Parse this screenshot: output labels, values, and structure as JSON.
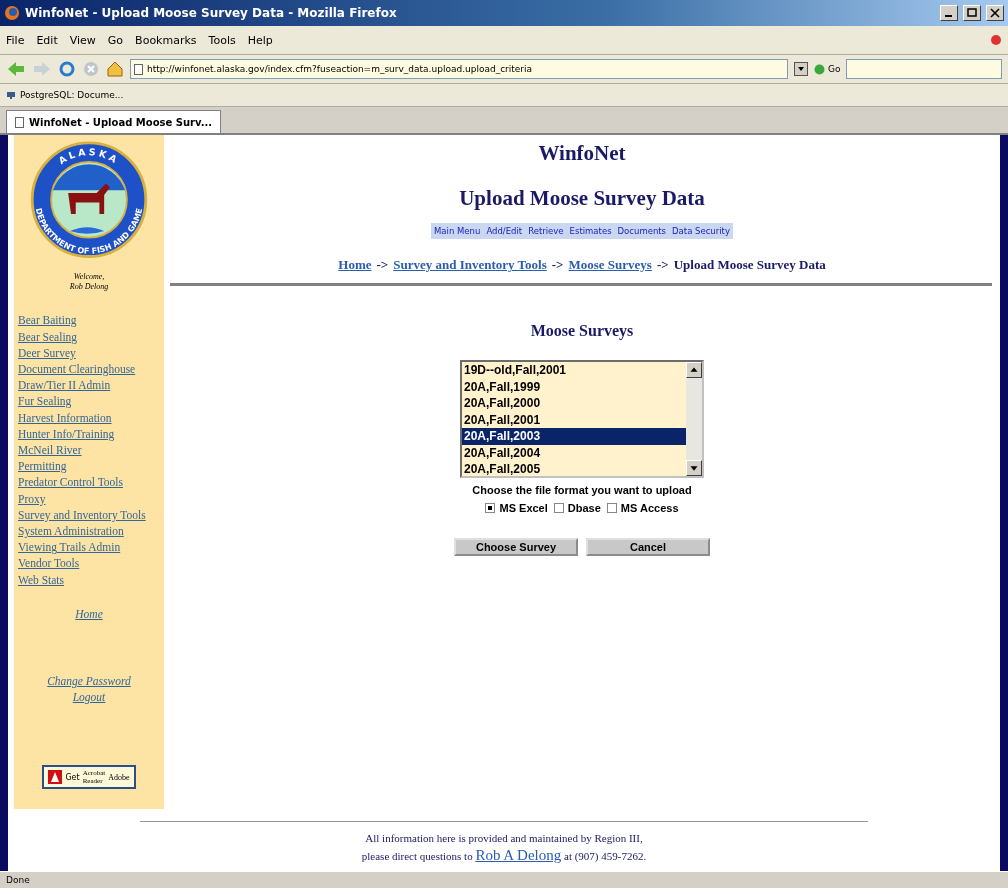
{
  "window": {
    "title": "WinfoNet - Upload Moose Survey Data - Mozilla Firefox"
  },
  "menu": [
    "File",
    "Edit",
    "View",
    "Go",
    "Bookmarks",
    "Tools",
    "Help"
  ],
  "toolbar": {
    "url": "http://winfonet.alaska.gov/index.cfm?fuseaction=m_surv_data.upload.upload_criteria",
    "go_label": "Go"
  },
  "bookmarks": [
    "PostgreSQL: Docume..."
  ],
  "tabs": [
    {
      "label": "WinfoNet - Upload Moose Surv...",
      "selected": true
    }
  ],
  "sidebar": {
    "logo": {
      "top_text": "ALASKA",
      "ring_text": "DEPARTMENT OF FISH AND GAME"
    },
    "welcome": [
      "Welcome,",
      "Rob Delong"
    ],
    "links": [
      "Bear Baiting",
      "Bear Sealing",
      "Deer Survey",
      "Document Clearinghouse",
      "Draw/Tier II Admin",
      "Fur Sealing",
      "Harvest Information",
      "Hunter Info/Training",
      "McNeil River",
      "Permitting",
      "Predator Control Tools",
      "Proxy",
      "Survey and Inventory Tools",
      "System Administration",
      "Viewing Trails Admin",
      "Vendor Tools",
      "Web Stats"
    ],
    "home_link": "Home",
    "account_links": [
      "Change Password",
      "Logout"
    ],
    "acrobat_badge": {
      "get": "Get",
      "product": "Acrobat",
      "reader": "Reader",
      "maker": "Adobe"
    }
  },
  "main": {
    "site_title": "WinfoNet",
    "page_title": "Upload Moose Survey Data",
    "nav_menu": [
      "Main Menu",
      "Add/Edit",
      "Retrieve",
      "Estimates",
      "Documents",
      "Data Security"
    ],
    "breadcrumb": [
      {
        "kind": "link",
        "text": "Home"
      },
      {
        "kind": "separator",
        "text": "->"
      },
      {
        "kind": "link",
        "text": "Survey and Inventory Tools"
      },
      {
        "kind": "separator",
        "text": "->"
      },
      {
        "kind": "link",
        "text": "Moose Surveys"
      },
      {
        "kind": "separator",
        "text": "->"
      },
      {
        "kind": "current",
        "text": "Upload Moose Survey Data"
      }
    ],
    "section_title": "Moose Surveys",
    "surveys": [
      {
        "label": "19D--old,Fall,2001",
        "selected": false
      },
      {
        "label": "20A,Fall,1999",
        "selected": false
      },
      {
        "label": "20A,Fall,2000",
        "selected": false
      },
      {
        "label": "20A,Fall,2001",
        "selected": false
      },
      {
        "label": "20A,Fall,2003",
        "selected": true
      },
      {
        "label": "20A,Fall,2004",
        "selected": false
      },
      {
        "label": "20A,Fall,2005",
        "selected": false
      }
    ],
    "format_prompt": "Choose the file format you want to upload",
    "formats": [
      {
        "label": "MS Excel",
        "selected": true
      },
      {
        "label": "Dbase",
        "selected": false
      },
      {
        "label": "MS Access",
        "selected": false
      }
    ],
    "buttons": [
      "Choose Survey",
      "Cancel"
    ]
  },
  "footer": {
    "line1": "All information here is provided and maintained by Region III,",
    "prefix": "please direct questions to",
    "contact_link": "Rob A Delong",
    "suffix": "at (907) 459-7262."
  },
  "status_bar": "Done"
}
